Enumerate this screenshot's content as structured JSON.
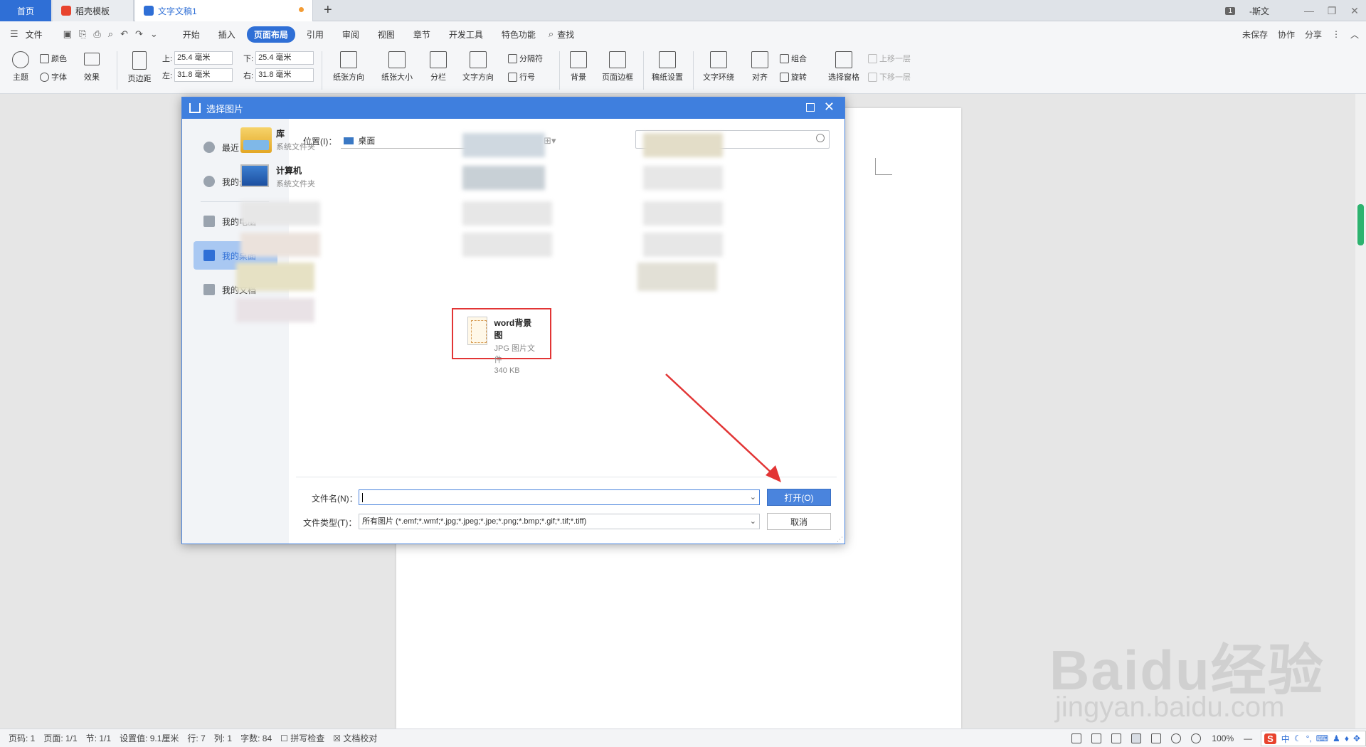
{
  "tabs": {
    "home": "首页",
    "template": "稻壳模板",
    "document": "文字文稿1",
    "add": "+"
  },
  "titlebar_right": {
    "badge": "1",
    "user": "-斯文"
  },
  "menu": {
    "file": "文件",
    "items": [
      "开始",
      "插入",
      "页面布局",
      "引用",
      "审阅",
      "视图",
      "章节",
      "开发工具",
      "特色功能"
    ],
    "active_index": 2,
    "search": "查找",
    "right": [
      "未保存",
      "协作",
      "分享"
    ]
  },
  "ribbon": {
    "theme": "主题",
    "color": "颜色",
    "font": "字体",
    "effect": "效果",
    "margins": "页边距",
    "top_label": "上:",
    "top_value": "25.4 毫米",
    "bottom_label": "下:",
    "bottom_value": "25.4 毫米",
    "left_label": "左:",
    "left_value": "31.8 毫米",
    "right_label": "右:",
    "right_value": "31.8 毫米",
    "orientation": "纸张方向",
    "size": "纸张大小",
    "columns": "分栏",
    "text_direction": "文字方向",
    "separator": "分隔符",
    "line_number": "行号",
    "background": "背景",
    "page_border": "页面边框",
    "draft_setting": "稿纸设置",
    "text_wrap": "文字环绕",
    "align": "对齐",
    "group": "组合",
    "rotate": "旋转",
    "selection_pane": "选择窗格",
    "bring_forward": "上移一层",
    "send_backward": "下移一层"
  },
  "dialog": {
    "title": "选择图片",
    "sidebar": [
      "最近",
      "我的云文档",
      "我的电脑",
      "我的桌面",
      "我的文档"
    ],
    "active_sidebar_index": 3,
    "location_label": "位置(I)：",
    "location_value": "桌面",
    "files": [
      {
        "name": "库",
        "desc": "系统文件夹"
      },
      {
        "name": "计算机",
        "desc": "系统文件夹"
      },
      {
        "name": "word背景图",
        "desc": "JPG 图片文件",
        "size": "340 KB"
      }
    ],
    "filename_label": "文件名(N)：",
    "filename_value": "",
    "filetype_label": "文件类型(T)：",
    "filetype_value": "所有图片 (*.emf;*.wmf;*.jpg;*.jpeg;*.jpe;*.png;*.bmp;*.gif;*.tif;*.tiff)",
    "open_button": "打开(O)",
    "cancel_button": "取消"
  },
  "status": {
    "page_num": "页码: 1",
    "pages": "页面: 1/1",
    "section": "节: 1/1",
    "setting": "设置值: 9.1厘米",
    "row": "行: 7",
    "col": "列: 1",
    "words": "字数: 84",
    "spell": "拼写检查",
    "proof": "文档校对",
    "zoom": "100%"
  },
  "ime": {
    "logo": "S",
    "lang": "中"
  },
  "watermark": {
    "brand": "Baidu经验",
    "url": "jingyan.baidu.com"
  },
  "colors": {
    "accent": "#2f6fd6",
    "dialog_title": "#3f7fde",
    "highlight_border": "#e23535",
    "arrow": "#e23535"
  }
}
